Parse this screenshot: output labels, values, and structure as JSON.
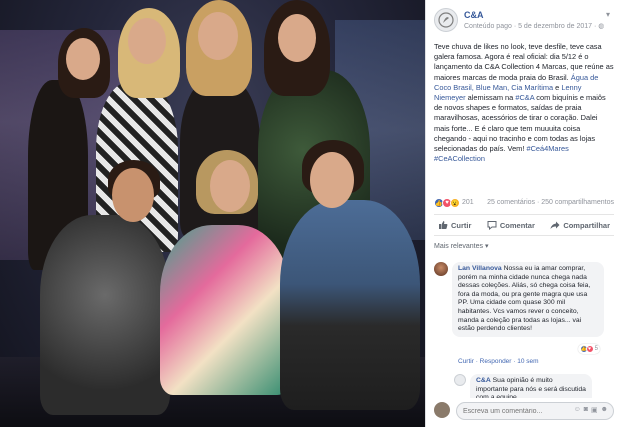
{
  "post": {
    "author": "C&A",
    "meta": "Conteúdo pago · 5 de dezembro de 2017 · ",
    "text_parts": [
      {
        "t": "Teve chuva de likes no look, teve desfile, teve casa galera famosa. Agora é real oficial: dia 5/12 é o lançamento da C&A Collection 4 Marcas, que reúne as maiores marcas de moda praia do Brasil. ",
        "link": false
      },
      {
        "t": "Água de Coco Brasil, Blue Man, Cia Marítima",
        "link": true
      },
      {
        "t": " e ",
        "link": false
      },
      {
        "t": "Lenny Niemeyer",
        "link": true
      },
      {
        "t": " alemissam na ",
        "link": false
      },
      {
        "t": "#C&A",
        "link": true
      },
      {
        "t": " com biquínis e maiôs de novos shapes e formatos, saídas de praia maravilhosas, acessórios de tirar o coração. Dalei mais forte... E é claro que tem muuuita coisa chegando - aqui no tracinho e com todas as lojas selecionadas do país. Vem! ",
        "link": false
      },
      {
        "t": "#Ceá4Mares #CeACollection",
        "link": true
      }
    ],
    "reaction_count": "201",
    "comments_count": "25 comentários · 250 compartilhamentos",
    "actions": {
      "like": "Curtir",
      "comment": "Comentar",
      "share": "Compartilhar"
    },
    "sort_label": "Mais relevantes"
  },
  "comments": [
    {
      "name": "Lan Villanova",
      "text": "Nossa eu ia amar comprar, porém na minha cidade nunca chega nada dessas coleções. Aliás, só chega coisa feia, fora da moda, ou pra gente magra que usa PP. Uma cidade com quase 300 mil habitantes. Vcs vamos rever o conceito, manda a coleção pra todas as lojas... vai estão perdendo clientes!",
      "actions": "Curtir · Responder · 10 sem",
      "react_count": "5"
    },
    {
      "name": "C&A",
      "text": "Sua opinião é muito importante para nós e será discutida com a equipe...",
      "actions": ""
    }
  ],
  "write": {
    "placeholder": "Escreva um comentário..."
  },
  "colors": {
    "brand_link": "#365899",
    "like_blue": "#4267b2",
    "love_red": "#f25268"
  }
}
